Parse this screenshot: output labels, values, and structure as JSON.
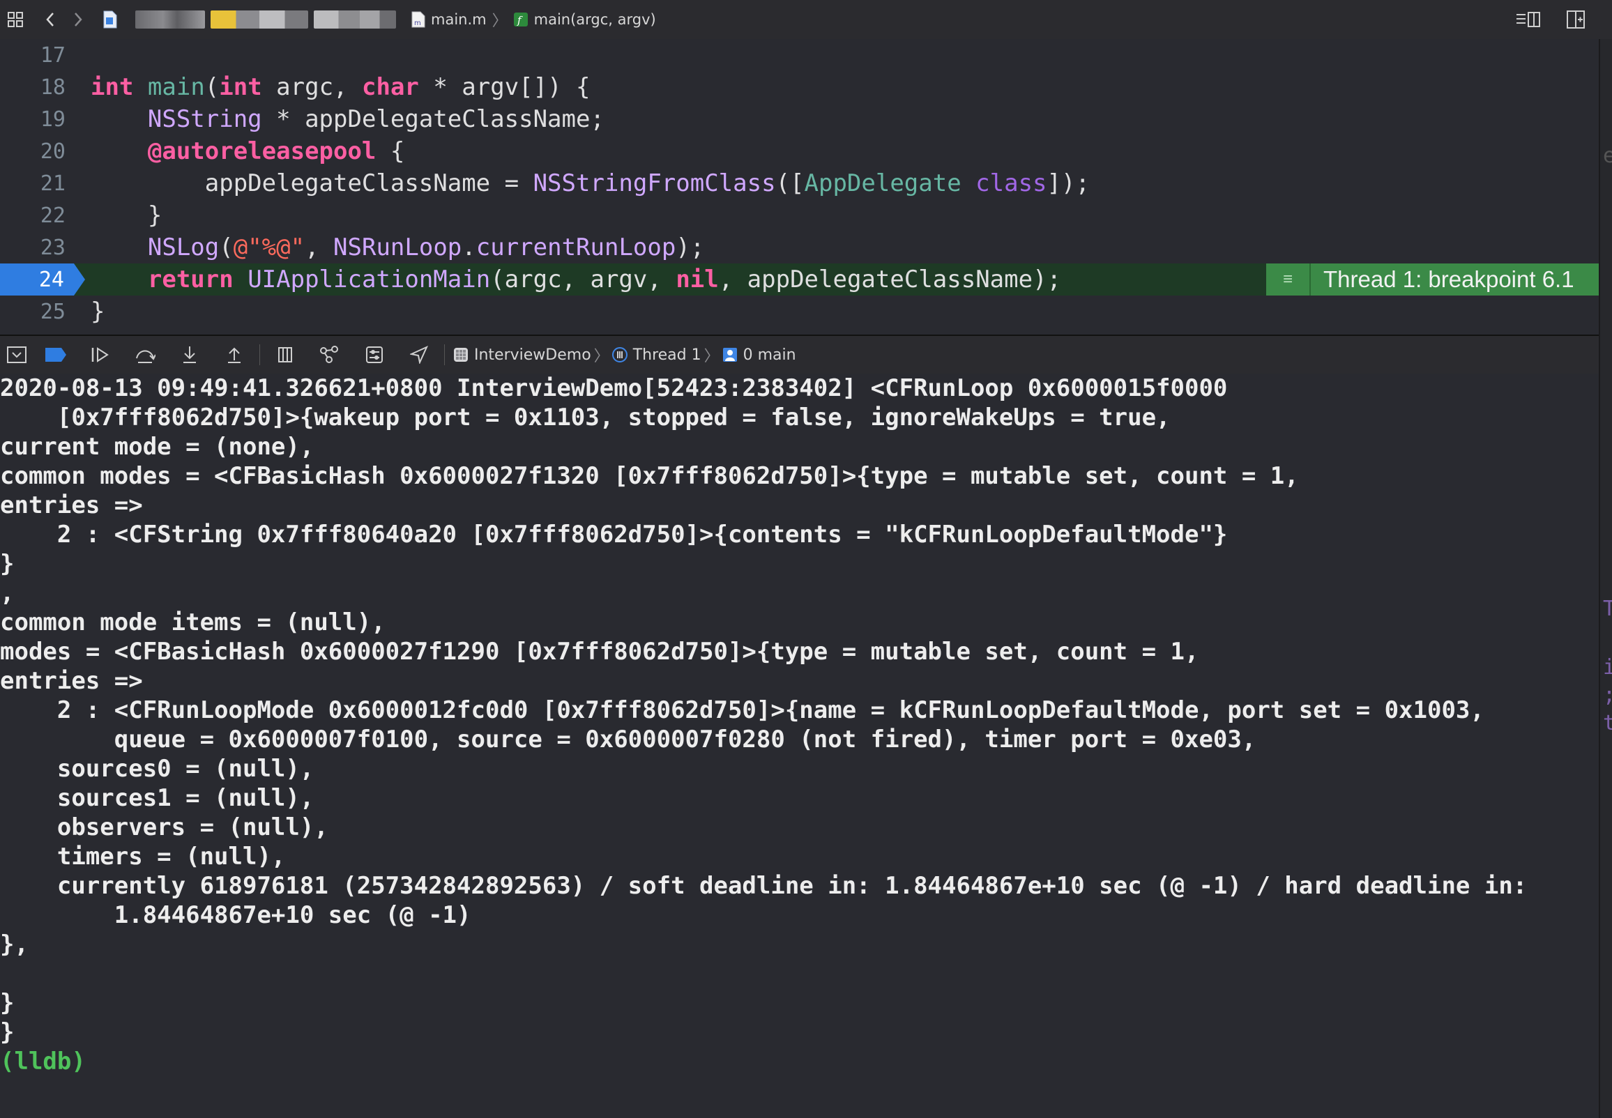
{
  "jumpbar": {
    "file": "main.m",
    "function": "main(argc, argv)"
  },
  "editor": {
    "lines": [
      {
        "n": "17"
      },
      {
        "n": "18"
      },
      {
        "n": "19"
      },
      {
        "n": "20"
      },
      {
        "n": "21"
      },
      {
        "n": "22"
      },
      {
        "n": "23"
      },
      {
        "n": "24"
      },
      {
        "n": "25"
      }
    ],
    "breakpoint_label": "Thread 1: breakpoint 6.1"
  },
  "debugbar": {
    "app": "InterviewDemo",
    "thread": "Thread 1",
    "frame": "0 main"
  },
  "console": {
    "lines": [
      "2020-08-13 09:49:41.326621+0800 InterviewDemo[52423:2383402] <CFRunLoop 0x6000015f0000",
      "    [0x7fff8062d750]>{wakeup port = 0x1103, stopped = false, ignoreWakeUps = true,",
      "current mode = (none),",
      "common modes = <CFBasicHash 0x6000027f1320 [0x7fff8062d750]>{type = mutable set, count = 1,",
      "entries =>",
      "    2 : <CFString 0x7fff80640a20 [0x7fff8062d750]>{contents = \"kCFRunLoopDefaultMode\"}",
      "}",
      ",",
      "common mode items = (null),",
      "modes = <CFBasicHash 0x6000027f1290 [0x7fff8062d750]>{type = mutable set, count = 1,",
      "entries =>",
      "    2 : <CFRunLoopMode 0x6000012fc0d0 [0x7fff8062d750]>{name = kCFRunLoopDefaultMode, port set = 0x1003,",
      "        queue = 0x6000007f0100, source = 0x6000007f0280 (not fired), timer port = 0xe03,",
      "    sources0 = (null),",
      "    sources1 = (null),",
      "    observers = (null),",
      "    timers = (null),",
      "    currently 618976181 (257342842892563) / soft deadline in: 1.84464867e+10 sec (@ -1) / hard deadline in:",
      "        1.84464867e+10 sec (@ -1)",
      "},",
      "",
      "}",
      "}"
    ],
    "prompt": "(lldb)"
  },
  "colors": {
    "background": "#292a30",
    "keyword": "#fc5fa3",
    "type": "#d0a8ff",
    "function": "#67b7a4",
    "string": "#fc6a5d",
    "breakpoint": "#2f7de1",
    "thread_badge": "#3b8a47",
    "prompt": "#4fc35b"
  }
}
